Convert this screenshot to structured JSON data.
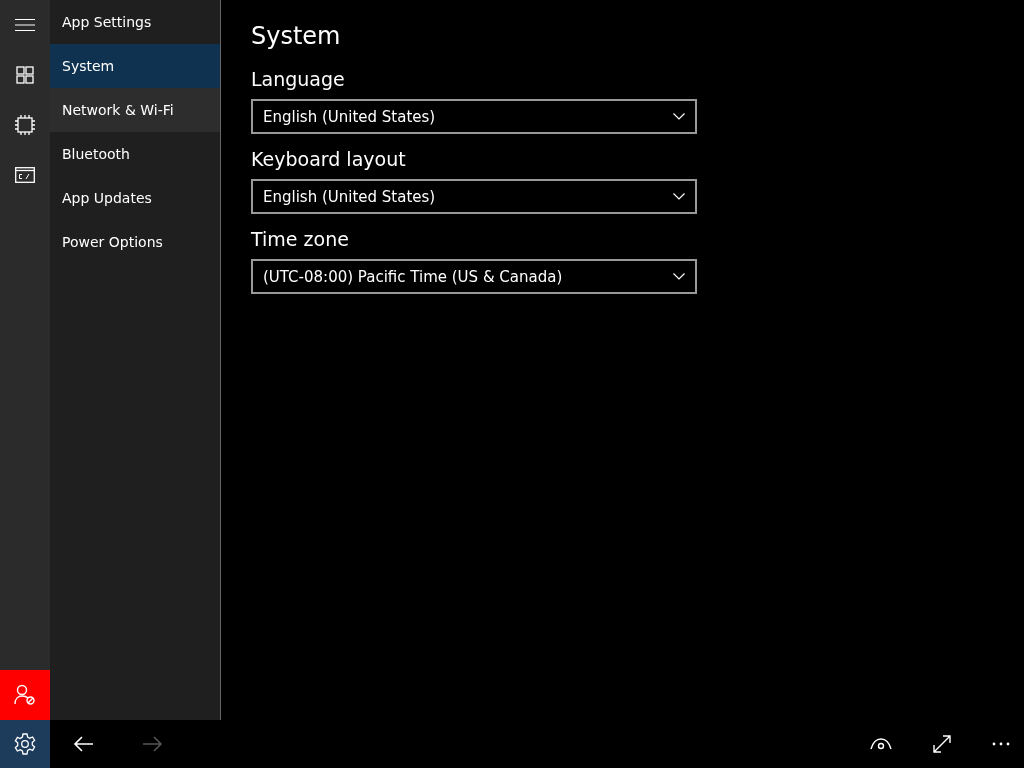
{
  "rail": {
    "items": [
      {
        "kind": "menu"
      },
      {
        "kind": "apps"
      },
      {
        "kind": "chip"
      },
      {
        "kind": "console"
      }
    ],
    "bottom": [
      {
        "kind": "user-blocked"
      },
      {
        "kind": "settings",
        "selected": true
      }
    ]
  },
  "sidebar": {
    "title": "App Settings",
    "items": [
      {
        "label": "System",
        "selected": true,
        "hovered": false
      },
      {
        "label": "Network & Wi-Fi",
        "selected": false,
        "hovered": true
      },
      {
        "label": "Bluetooth",
        "selected": false,
        "hovered": false
      },
      {
        "label": "App Updates",
        "selected": false,
        "hovered": false
      },
      {
        "label": "Power Options",
        "selected": false,
        "hovered": false
      }
    ]
  },
  "page": {
    "title": "System",
    "fields": [
      {
        "label": "Language",
        "value": "English (United States)"
      },
      {
        "label": "Keyboard layout",
        "value": "English (United States)"
      },
      {
        "label": "Time zone",
        "value": "(UTC-08:00) Pacific Time (US & Canada)"
      }
    ]
  },
  "nav": {
    "back_disabled": false,
    "forward_disabled": true
  }
}
